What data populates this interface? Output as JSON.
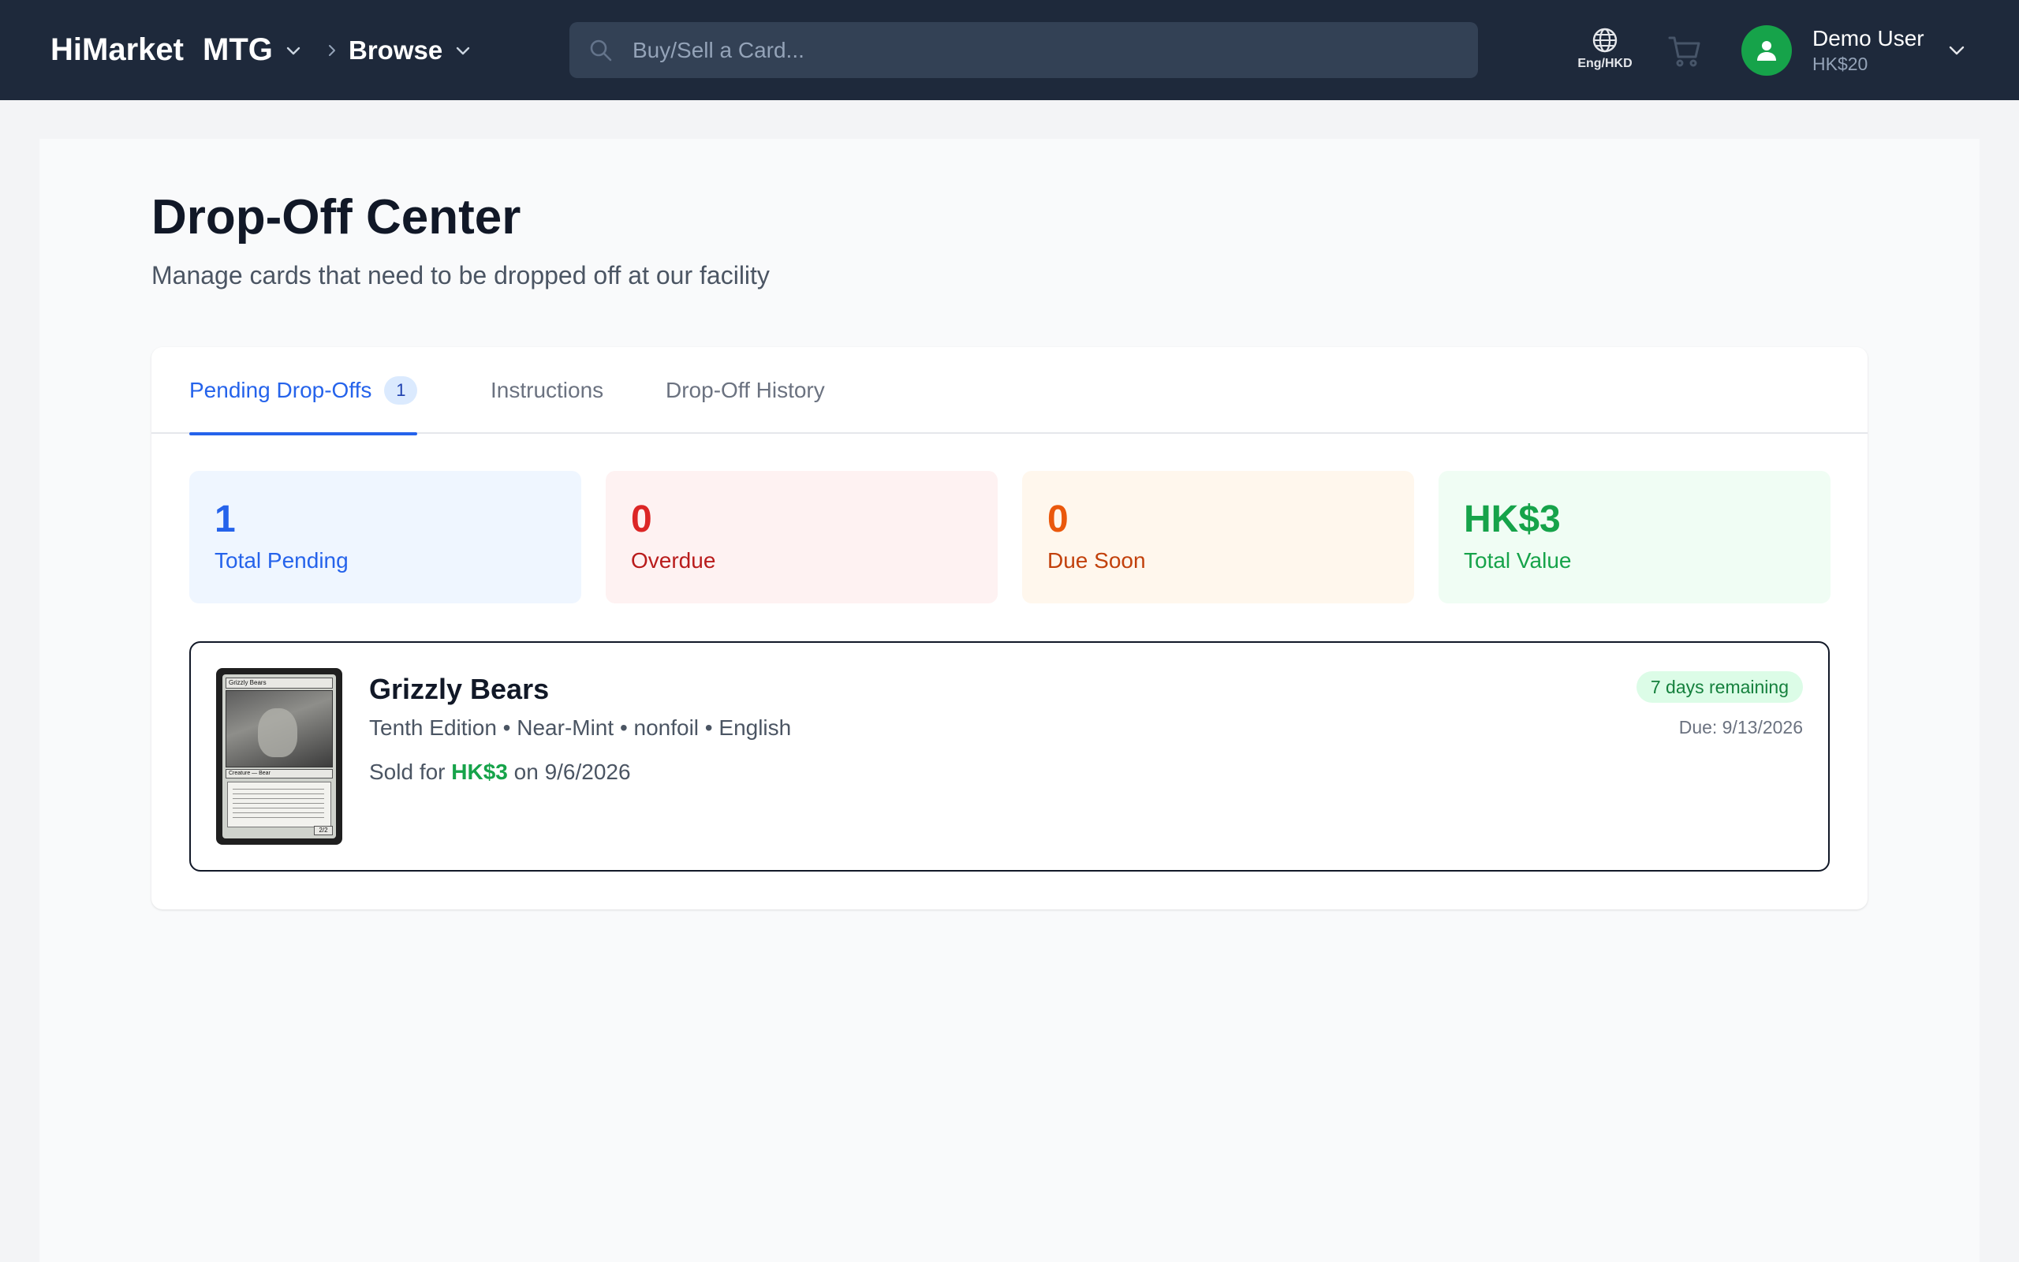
{
  "header": {
    "brand": "HiMarket",
    "game": "MTG",
    "browse": "Browse",
    "search_placeholder": "Buy/Sell a Card...",
    "language": "Eng/HKD",
    "user_name": "Demo User",
    "user_balance": "HK$20"
  },
  "page": {
    "title": "Drop-Off Center",
    "subtitle": "Manage cards that need to be dropped off at our facility"
  },
  "tabs": [
    {
      "label": "Pending Drop-Offs",
      "badge": "1",
      "active": true
    },
    {
      "label": "Instructions",
      "active": false
    },
    {
      "label": "Drop-Off History",
      "active": false
    }
  ],
  "stats": [
    {
      "value": "1",
      "label": "Total Pending",
      "color": "#2563eb"
    },
    {
      "value": "0",
      "label": "Overdue",
      "color": "#dc2626"
    },
    {
      "value": "0",
      "label": "Due Soon",
      "color": "#ea580c"
    },
    {
      "value": "HK$3",
      "label": "Total Value",
      "color": "#16a34a"
    }
  ],
  "items": [
    {
      "name": "Grizzly Bears",
      "meta": "Tenth Edition • Near-Mint • nonfoil • English",
      "sold_prefix": "Sold for",
      "sold_price": "HK$3",
      "sold_suffix": "on 9/6/2026",
      "days_remaining": "7 days remaining",
      "due": "Due: 9/13/2026",
      "thumb_name": "Grizzly Bears",
      "thumb_type": "Creature — Bear",
      "thumb_pt": "2/2"
    }
  ],
  "colors": {
    "nav_bg": "#1e293b",
    "accent": "#2563eb",
    "success": "#16a34a"
  }
}
